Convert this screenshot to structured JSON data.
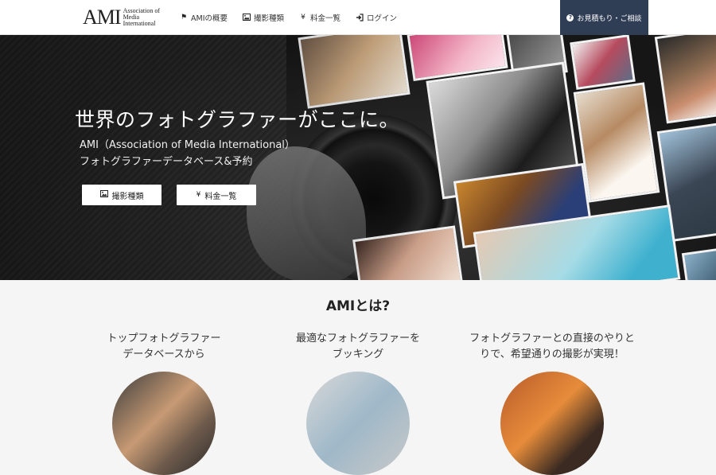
{
  "header": {
    "logo_mark": "AMI",
    "logo_sub": [
      "Association of",
      "Media",
      "International"
    ],
    "nav": [
      {
        "label": "AMIの概要",
        "icon": "flag-icon"
      },
      {
        "label": "撮影種類",
        "icon": "image-icon"
      },
      {
        "label": "料金一覧",
        "icon": "yen-icon"
      },
      {
        "label": "ログイン",
        "icon": "login-icon"
      }
    ],
    "cta": {
      "label": "お見積もり・ご相談",
      "icon": "question-circle-icon"
    }
  },
  "hero": {
    "title": "世界のフォトグラファーがここに。",
    "subtitle_line1": "AMI（Association of Media International）",
    "subtitle_line2": "フォトグラファーデータベース&予約",
    "buttons": [
      {
        "label": "撮影種類",
        "icon": "image-icon"
      },
      {
        "label": "料金一覧",
        "icon": "yen-icon"
      }
    ]
  },
  "about": {
    "title": "AMIとは?",
    "columns": [
      {
        "line1": "トップフォトグラファー",
        "line2": "データベースから"
      },
      {
        "line1": "最適なフォトグラファーを",
        "line2": "ブッキング"
      },
      {
        "line1": "フォトグラファーとの直接のやりと",
        "line2": "りで、希望通りの撮影が実現！"
      }
    ]
  },
  "colors": {
    "cta_bg": "#2f3d55",
    "header_bg": "#ffffff",
    "page_bg": "#f5f5f5"
  }
}
